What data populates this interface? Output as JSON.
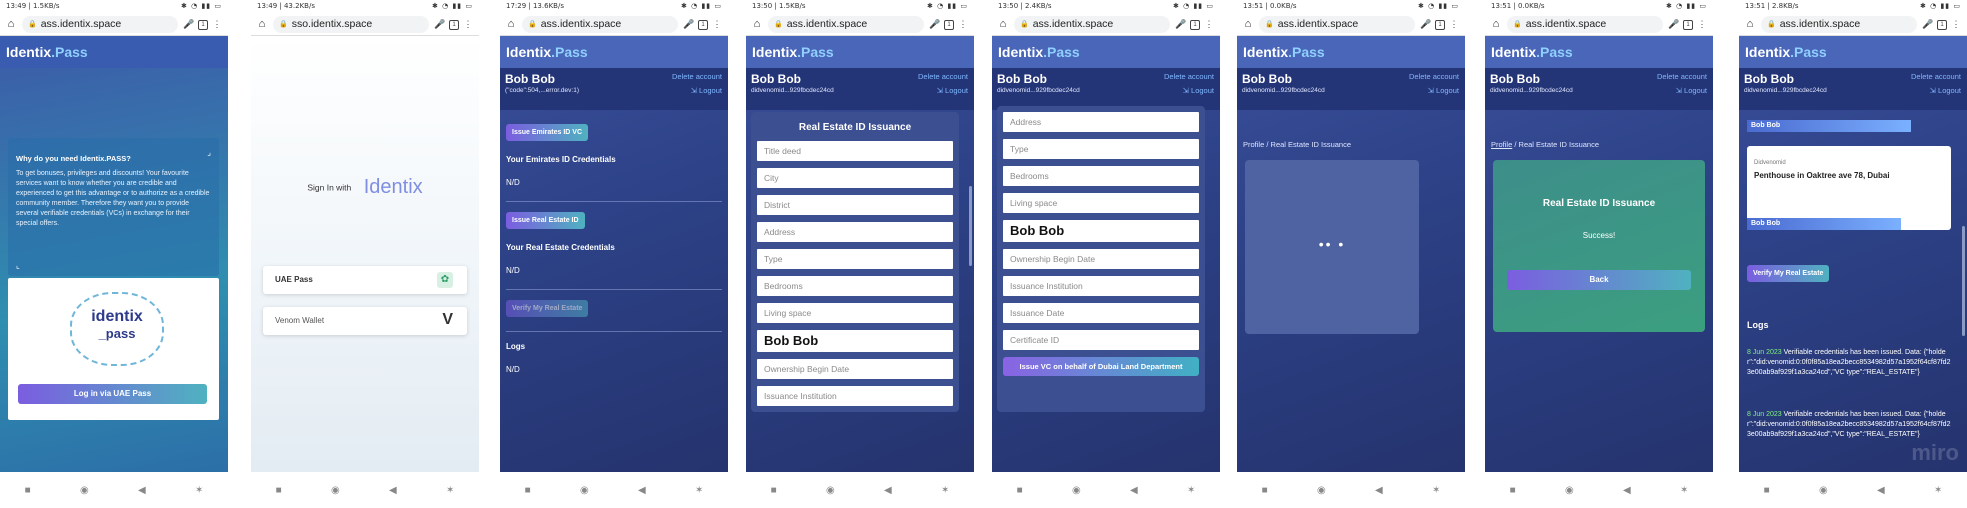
{
  "colors": {
    "accent": "#4fb2c0",
    "header": "#4a66b8",
    "link": "#7fb7ff"
  },
  "phones": [
    {
      "time": "13:49 | 1.5KB/s",
      "url": "ass.identix.space"
    },
    {
      "time": "13:49 | 43.2KB/s",
      "url": "sso.identix.space"
    },
    {
      "time": "17:29 | 13.6KB/s",
      "url": "ass.identix.space"
    },
    {
      "time": "13:50 | 1.5KB/s",
      "url": "ass.identix.space"
    },
    {
      "time": "13:50 | 2.4KB/s",
      "url": "ass.identix.space"
    },
    {
      "time": "13:51 | 0.0KB/s",
      "url": "ass.identix.space"
    },
    {
      "time": "13:51 | 0.0KB/s",
      "url": "ass.identix.space"
    },
    {
      "time": "13:51 | 2.8KB/s",
      "url": "ass.identix.space"
    }
  ],
  "app": {
    "brand": "Identix",
    "brand_suffix": ".Pass",
    "user": "Bob Bob",
    "delete": "Delete account",
    "logout": "Logout",
    "user_id_short": "didvenomid...929fbcdec24cd"
  },
  "p1": {
    "panel_title": "Why do you need Identix.PASS?",
    "panel_text": "To get bonuses, privileges and discounts! Your favourite services want to know whether you are credible and experienced to get this advantage or to authorize as a credible community member. Therefore they want you to provide several verifiable credentials (VCs) in exchange for their special offers.",
    "logo_line1": "identix",
    "logo_line2": "_pass",
    "login_btn": "Log in via UAE Pass"
  },
  "p2": {
    "sign_in": "Sign In with",
    "brand": "Identix",
    "opt1": "UAE Pass",
    "opt2": "Venom Wallet"
  },
  "p3": {
    "user_id": "(\"code\":504,...error.dev:1)",
    "btn_emirates": "Issue Emirates ID VC",
    "emirates_title": "Your Emirates ID Credentials",
    "na": "N/D",
    "btn_real": "Issue Real Estate ID",
    "real_title": "Your Real Estate Credentials",
    "btn_verify": "Verify My Real Estate",
    "logs": "Logs"
  },
  "p4": {
    "title": "Real Estate ID Issuance",
    "fields": [
      "Title deed",
      "City",
      "District",
      "Address",
      "Type",
      "Bedrooms",
      "Living space"
    ],
    "filled": "Bob Bob",
    "fields2": [
      "Ownership Begin Date",
      "Issuance Institution"
    ]
  },
  "p5": {
    "fields": [
      "Address",
      "Type",
      "Bedrooms",
      "Living space"
    ],
    "filled": "Bob Bob",
    "fields2": [
      "Ownership Begin Date",
      "Issuance Institution",
      "Issuance Date",
      "Certificate ID"
    ],
    "submit": "Issue VC on behalf of Dubai Land Department"
  },
  "p6": {
    "crumb_root": "Profile",
    "crumb_sep": "/",
    "crumb_leaf": "Real Estate ID Issuance",
    "spinner": "•• •"
  },
  "p7": {
    "crumb_root": "Profile",
    "crumb_sep": "/",
    "crumb_leaf": "Real Estate ID Issuance",
    "title": "Real Estate ID Issuance",
    "msg": "Success!",
    "back": "Back"
  },
  "p8": {
    "card_tag": "Bob Bob",
    "card_label": "Didvenomid",
    "card_value": "Penthouse in Oaktree ave 78, Dubai",
    "card_footer": "Bob Bob",
    "verify": "Verify My Real Estate",
    "logs": "Logs",
    "log1_date": "8 Jun 2023",
    "log1_text": "Verifiable credentials has been issued. Data: {\"holder\":\"did:venomid:0:0f0f85a18ea2becc8534982d57a1952f64cf87fd23e00ab9af929f1a3ca24cd\",\"VC type\":\"REAL_ESTATE\"}",
    "log2_date": "8 Jun 2023",
    "log2_text": "Verifiable credentials has been issued. Data: {\"holder\":\"did:venomid:0:0f0f85a18ea2becc8534982d57a1952f64cf87fd23e00ab9af929f1a3ca24cd\",\"VC type\":\"REAL_ESTATE\"}",
    "watermark": "miro"
  },
  "nav": {
    "square": "■",
    "circle": "◉",
    "back": "◀",
    "acc": "✶"
  }
}
